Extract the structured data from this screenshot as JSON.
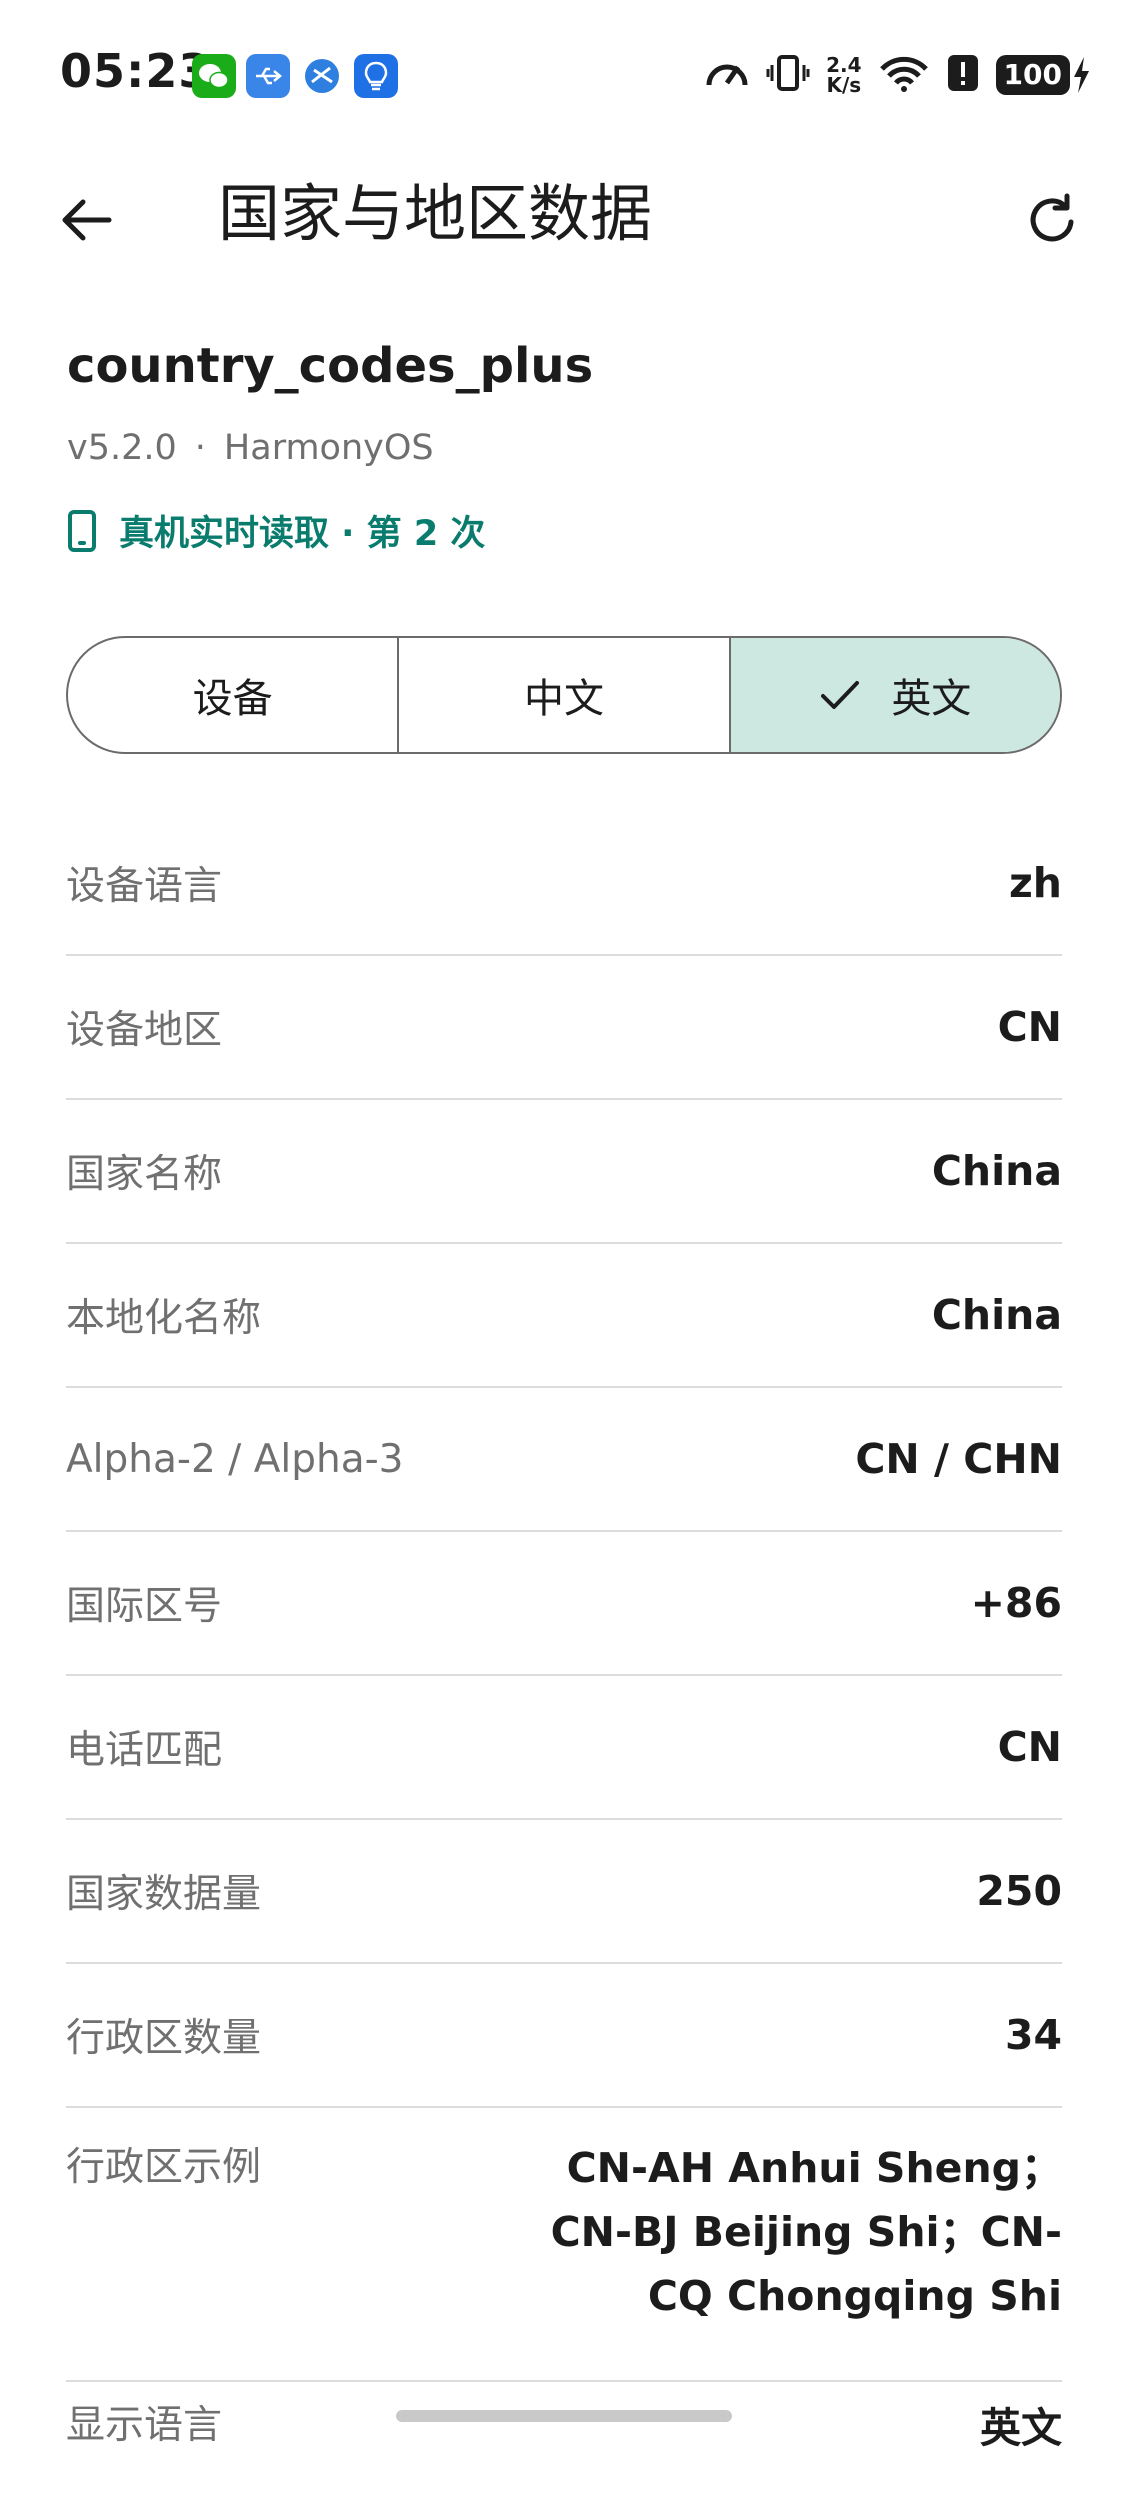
{
  "status_bar": {
    "time": "05:23",
    "app_icons": [
      {
        "name": "wechat-icon",
        "color": "#1aad19"
      },
      {
        "name": "usb-icon",
        "color": "#3a86e8"
      },
      {
        "name": "browser-icon",
        "color": "#2f7fe0"
      },
      {
        "name": "tips-icon",
        "color": "#1f6fe5"
      }
    ],
    "net_speed_top": "2.4",
    "net_speed_bottom": "K/s",
    "battery": "100"
  },
  "app_bar": {
    "title": "国家与地区数据",
    "back_icon": "arrow-left-icon",
    "refresh_icon": "refresh-icon"
  },
  "package": {
    "name": "country_codes_plus",
    "version": "v5.2.0",
    "separator": "·",
    "platform": "HarmonyOS",
    "live_read": "真机实时读取 · 第 2 次",
    "accent_color": "#0a7c6e"
  },
  "segments": [
    {
      "label": "设备",
      "selected": false
    },
    {
      "label": "中文",
      "selected": false
    },
    {
      "label": "英文",
      "selected": true
    }
  ],
  "rows": [
    {
      "label": "设备语言",
      "value": "zh"
    },
    {
      "label": "设备地区",
      "value": "CN"
    },
    {
      "label": "国家名称",
      "value": "China"
    },
    {
      "label": "本地化名称",
      "value": "China"
    },
    {
      "label": "Alpha-2 / Alpha-3",
      "value": "CN / CHN"
    },
    {
      "label": "国际区号",
      "value": "+86"
    },
    {
      "label": "电话匹配",
      "value": "CN"
    },
    {
      "label": "国家数据量",
      "value": "250"
    },
    {
      "label": "行政区数量",
      "value": "34"
    },
    {
      "label": "行政区示例",
      "value_lines": [
        "CN-AH Anhui Sheng；",
        "CN-BJ Beijing Shi；CN-",
        "CQ Chongqing Shi"
      ]
    },
    {
      "label": "显示语言",
      "value": "英文"
    }
  ]
}
